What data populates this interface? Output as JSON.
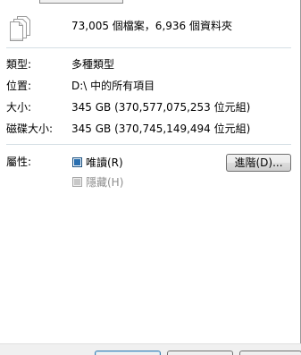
{
  "header": {
    "summary": "73,005 個檔案，6,936 個資料夾",
    "icon": "multiple-files-icon"
  },
  "properties": {
    "type": {
      "label": "類型:",
      "value": "多種類型"
    },
    "location": {
      "label": "位置:",
      "value": "D:\\ 中的所有項目"
    },
    "size": {
      "label": "大小:",
      "value": "345 GB (370,577,075,253 位元組)"
    },
    "size_on_disk": {
      "label": "磁碟大小:",
      "value": "345 GB (370,745,149,494 位元組)"
    }
  },
  "attributes": {
    "label": "屬性:",
    "readonly": {
      "label": "唯讀(R)",
      "state": "indeterminate"
    },
    "hidden": {
      "label": "隱藏(H)",
      "state": "indeterminate",
      "disabled": true
    },
    "advanced_button": "進階(D)..."
  },
  "colors": {
    "checkbox_fill": "#2a6fb0",
    "separator": "#d5dfe5",
    "disabled_text": "#8d8d8d"
  }
}
